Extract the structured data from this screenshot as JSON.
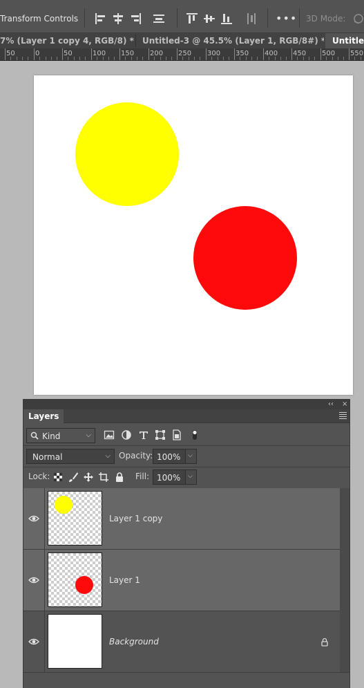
{
  "options_bar": {
    "transform_controls_label": "Transform Controls",
    "more_label": "•••",
    "mode_label": "3D Mode:"
  },
  "tabs": [
    {
      "label": "7% (Layer 1 copy 4, RGB/8) *",
      "close": "×",
      "active": false
    },
    {
      "label": "Untitled-3 @ 45.5% (Layer 1, RGB/8#) *",
      "close": "×",
      "active": false
    },
    {
      "label": "Untitled",
      "active": true
    }
  ],
  "ruler": {
    "labels": [
      "50",
      "0",
      "50",
      "100",
      "150",
      "200",
      "250",
      "300",
      "350",
      "400",
      "450",
      "500",
      "550"
    ]
  },
  "canvas": {
    "background": "#ffffff",
    "circles": [
      {
        "name": "yellow-circle",
        "color": "#ffff00"
      },
      {
        "name": "red-circle",
        "color": "#ff0a0a"
      }
    ]
  },
  "layers_panel": {
    "tab_label": "Layers",
    "collapse_glyph": "‹‹",
    "close_glyph": "×",
    "filter": {
      "kind_label": "Kind",
      "arrow": "⌵"
    },
    "blend_mode": "Normal",
    "opacity_label": "Opacity:",
    "opacity_value": "100%",
    "lock_label": "Lock:",
    "fill_label": "Fill:",
    "fill_value": "100%",
    "layers": [
      {
        "name": "Layer 1 copy",
        "selected": true,
        "thumb_circle_color": "#ffff00",
        "locked": false
      },
      {
        "name": "Layer 1",
        "selected": true,
        "thumb_circle_color": "#ff0a0a",
        "locked": false
      },
      {
        "name": "Background",
        "selected": false,
        "locked": true,
        "italic": true
      }
    ]
  }
}
